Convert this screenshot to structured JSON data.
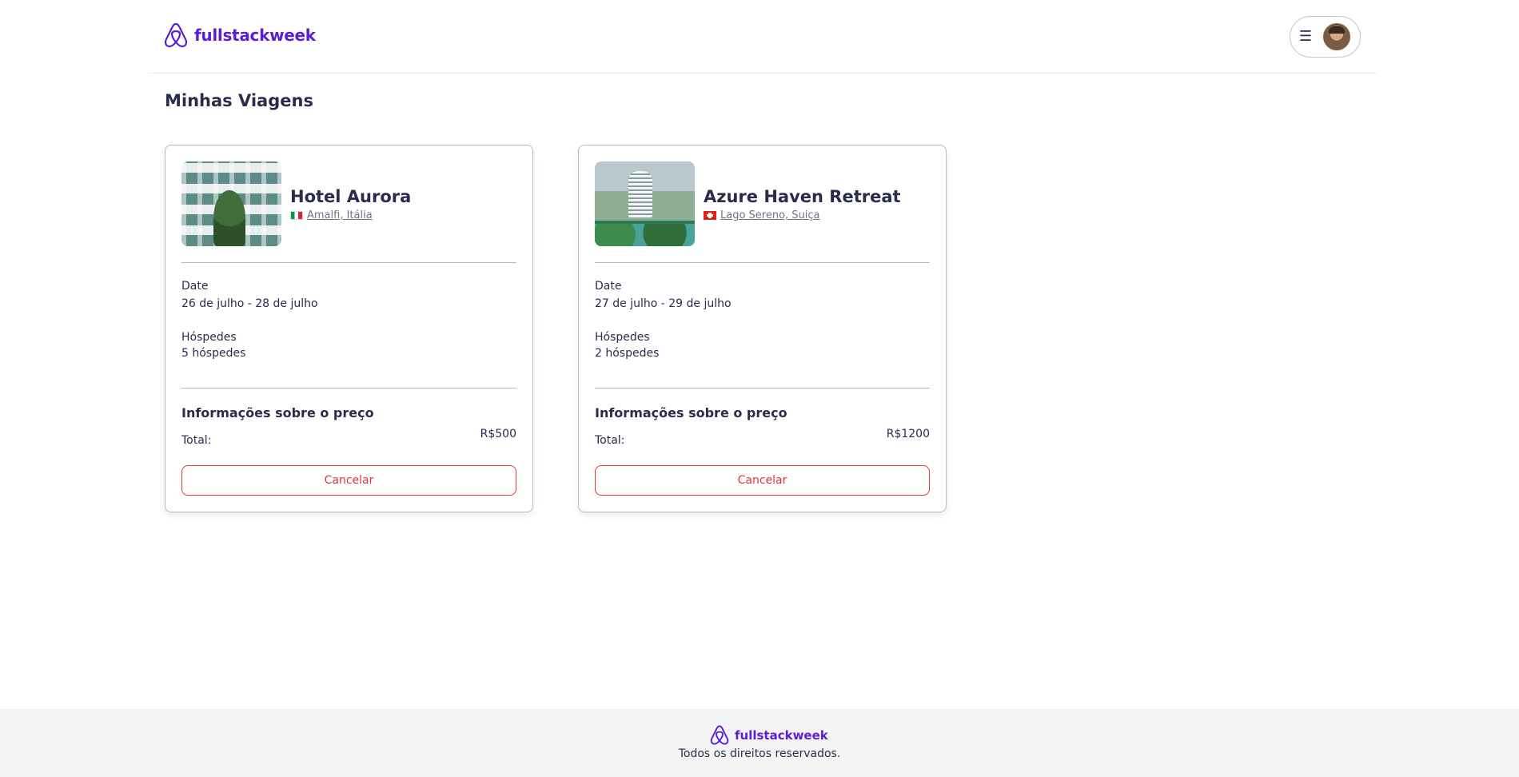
{
  "header": {
    "brand": "fullstackweek",
    "menu_icon": "hamburger-icon",
    "avatar": "user-avatar"
  },
  "page": {
    "title": "Minhas Viagens"
  },
  "trips": [
    {
      "hotel_name": "Hotel Aurora",
      "location": "Amalfi, Itália",
      "flag": "italy-flag-icon",
      "date_label": "Date",
      "date_value": "26 de julho - 28 de julho",
      "guests_label": "Hóspedes",
      "guests_value": "5 hóspedes",
      "price_title": "Informações sobre o preço",
      "total_label": "Total:",
      "total_value": "R$500",
      "cancel_label": "Cancelar"
    },
    {
      "hotel_name": "Azure Haven Retreat",
      "location": "Lago Sereno, Suiça",
      "flag": "switzerland-flag-icon",
      "date_label": "Date",
      "date_value": "27 de julho - 29 de julho",
      "guests_label": "Hóspedes",
      "guests_value": "2 hóspedes",
      "price_title": "Informações sobre o preço",
      "total_label": "Total:",
      "total_value": "R$1200",
      "cancel_label": "Cancelar"
    }
  ],
  "footer": {
    "brand": "fullstackweek",
    "copyright": "Todos os direitos reservados."
  },
  "colors": {
    "brand": "#5a1ed8",
    "text": "#2b2b4d",
    "danger": "#e0353b",
    "footer_bg": "#f4f4f5"
  }
}
